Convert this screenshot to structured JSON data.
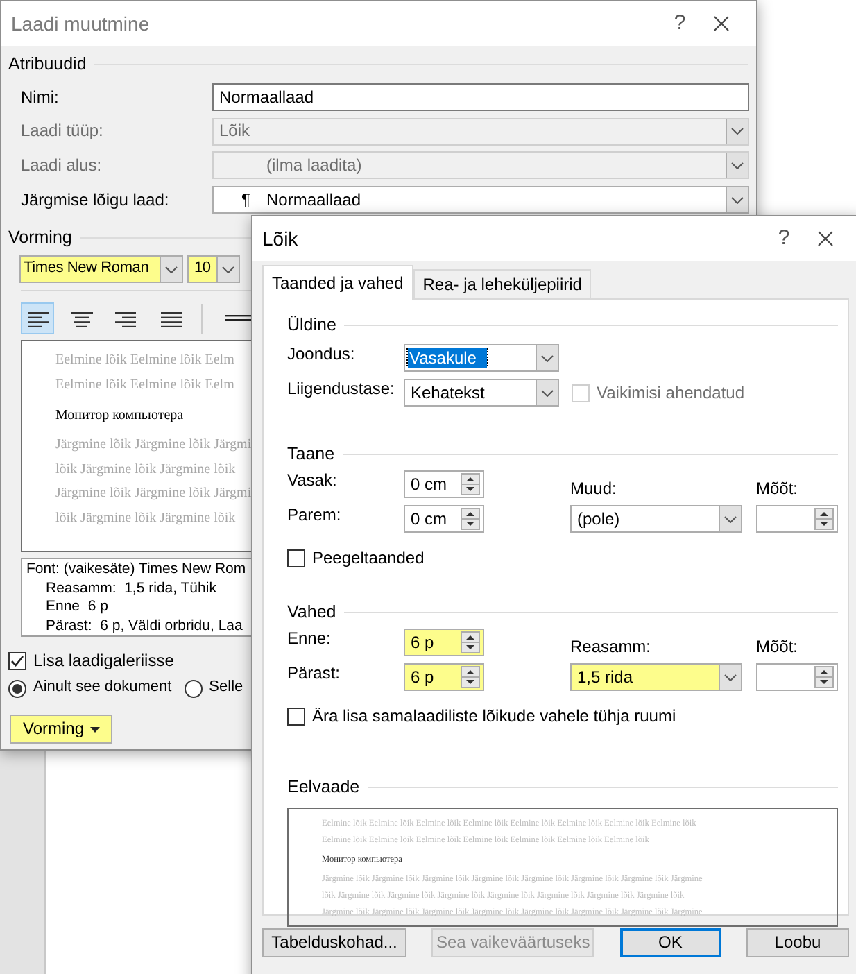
{
  "style_dialog": {
    "title": "Laadi muutmine",
    "help": "?",
    "attributes": {
      "heading": "Atribuudid",
      "rows": [
        {
          "label": "Nimi:",
          "kind": "text",
          "value": "Normaallaad",
          "disabled": false
        },
        {
          "label": "Laadi tüüp:",
          "kind": "select",
          "value": "Lõik",
          "disabled": true
        },
        {
          "label": "Laadi alus:",
          "kind": "style_select",
          "value": "(ilma laadita)",
          "disabled": true
        },
        {
          "label": "Järgmise lõigu laad:",
          "kind": "style_select",
          "marker": "¶",
          "value": "Normaallaad",
          "disabled": false
        }
      ]
    },
    "formatting": {
      "heading": "Vorming",
      "font": {
        "value": "Times New Roman",
        "highlighted": true
      },
      "size": {
        "value": "10",
        "highlighted": true
      },
      "alignment": [
        {
          "kind": "left",
          "selected": true
        },
        {
          "kind": "center",
          "selected": false
        },
        {
          "kind": "right",
          "selected": false
        },
        {
          "kind": "justify",
          "selected": false
        }
      ],
      "preview": {
        "before": [
          "Eelmine lõik Eelmine lõik Eelm",
          "Eelmine lõik Eelmine lõik Eelm"
        ],
        "sample": "Монитор компьютера",
        "after": [
          "Järgmine lõik Järgmine lõik Järgmi",
          "lõik Järgmine lõik Järgmine lõik",
          "Järgmine lõik Järgmine lõik Järgmi",
          "lõik Järgmine lõik Järgmine lõik"
        ]
      },
      "description": [
        "Font: (vaikesäte) Times New Rom",
        "Reasamm:  1,5 rida, Tühik",
        "Enne  6 p",
        "Pärast:  6 p, Väldi orbridu, Laa"
      ]
    },
    "add_to_gallery": {
      "label": "Lisa laadigaleriisse",
      "checked": true
    },
    "scope": [
      {
        "label": "Ainult see dokument",
        "selected": true
      },
      {
        "label": "Selle",
        "selected": false
      }
    ],
    "format_button": {
      "label": "Vorming",
      "highlighted": true
    }
  },
  "paragraph_dialog": {
    "title": "Lõik",
    "help": "?",
    "tabs": [
      {
        "label": "Taanded ja vahed",
        "selected": true
      },
      {
        "label": "Rea- ja leheküljepiirid",
        "selected": false
      }
    ],
    "general": {
      "heading": "Üldine",
      "alignment": {
        "label": "Joondus:",
        "value": "Vasakule",
        "focused": true
      },
      "outline": {
        "label": "Liigendustase:",
        "value": "Kehatekst",
        "focused": false
      },
      "collapsed": {
        "label": "Vaikimisi ahendatud",
        "checked": false,
        "disabled": true
      }
    },
    "indent": {
      "heading": "Taane",
      "left": {
        "label": "Vasak:",
        "value": "0 cm",
        "highlighted": false
      },
      "right": {
        "label": "Parem:",
        "value": "0 cm",
        "highlighted": false
      },
      "special": {
        "label": "Muud:",
        "value": "(pole)",
        "highlighted": false
      },
      "by": {
        "label": "Mõõt:"
      },
      "mirror": {
        "label": "Peegeltaanded",
        "checked": false
      }
    },
    "spacing": {
      "heading": "Vahed",
      "before": {
        "label": "Enne:",
        "value": "6 p",
        "highlighted": true
      },
      "after": {
        "label": "Pärast:",
        "value": "6 p",
        "highlighted": true
      },
      "line": {
        "label": "Reasamm:",
        "value": "1,5 rida",
        "highlighted": true
      },
      "at": {
        "label": "Mõõt:"
      },
      "no_space": {
        "label": "Ära lisa samalaadiliste lõikude vahele tühja ruumi",
        "checked": false
      }
    },
    "preview": {
      "heading": "Eelvaade",
      "before": [
        "Eelmine lõik Eelmine lõik Eelmine lõik Eelmine lõik Eelmine lõik Eelmine lõik Eelmine lõik Eelmine lõik",
        "Eelmine lõik Eelmine lõik Eelmine lõik Eelmine lõik Eelmine lõik Eelmine lõik Eelmine lõik"
      ],
      "sample": "Монитор компьютера",
      "after": [
        "Järgmine lõik Järgmine lõik Järgmine lõik Järgmine lõik Järgmine lõik Järgmine lõik Järgmine lõik Järgmine",
        "lõik Järgmine lõik Järgmine lõik Järgmine lõik Järgmine lõik Järgmine lõik Järgmine lõik Järgmine lõik",
        "Järgmine lõik Järgmine lõik Järgmine lõik Järgmine lõik Järgmine lõik Järgmine lõik Järgmine lõik Järgmine"
      ]
    },
    "buttons": [
      {
        "label": "Tabelduskohad...",
        "kind": "normal",
        "disabled": false
      },
      {
        "label": "Sea vaikeväärtuseks",
        "kind": "normal",
        "disabled": true
      },
      {
        "label": "OK",
        "kind": "default",
        "disabled": false
      },
      {
        "label": "Loobu",
        "kind": "normal",
        "disabled": false
      }
    ]
  }
}
